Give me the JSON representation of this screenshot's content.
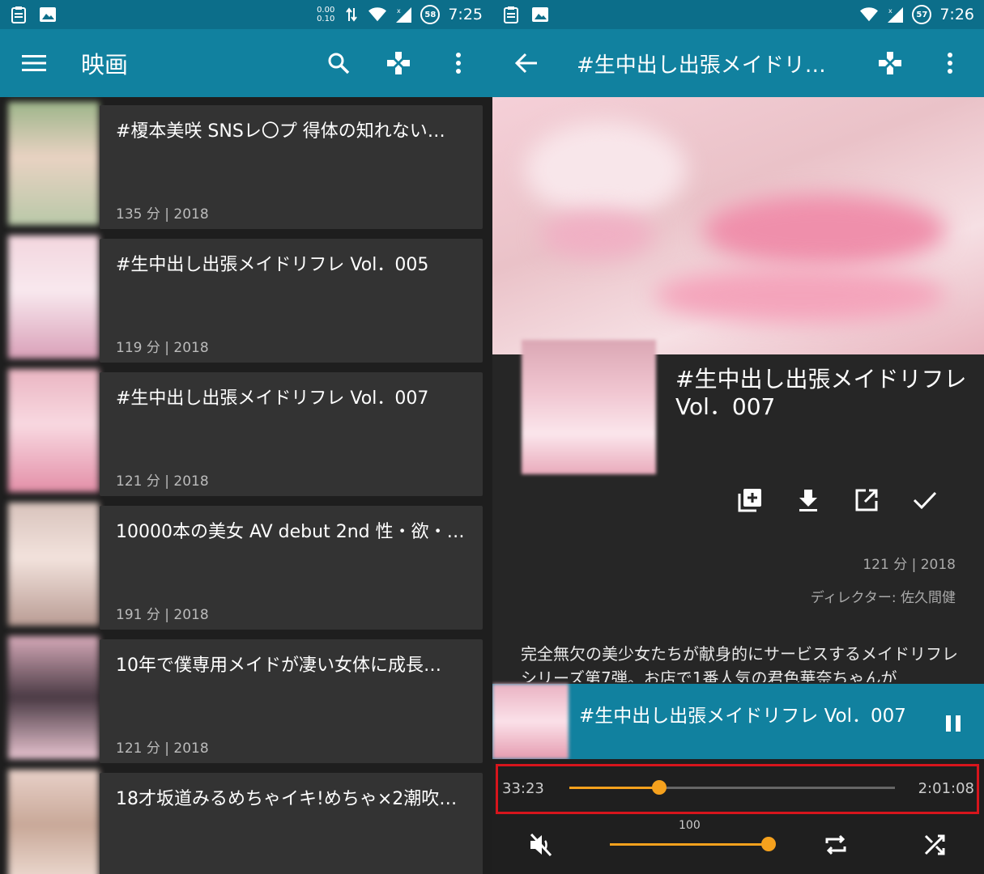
{
  "left": {
    "status": {
      "time": "7:25",
      "net_up": "0.00",
      "net_down": "0.10",
      "battery": "58"
    },
    "appbar": {
      "title": "映画"
    },
    "items": [
      {
        "title": "#榎本美咲 SNSレ〇プ 得体の知れない…",
        "meta": "135 分 | 2018",
        "colors": [
          "#b9c8a8",
          "#e8d2c2",
          "#9db58a"
        ]
      },
      {
        "title": "#生中出し出張メイドリフレ Vol．005",
        "meta": "119 分 | 2018",
        "colors": [
          "#f3d6de",
          "#f8e8ee",
          "#d9a0b8"
        ]
      },
      {
        "title": "#生中出し出張メイドリフレ Vol．007",
        "meta": "121 分 | 2018",
        "colors": [
          "#eab5c2",
          "#f8d8e0",
          "#e38fa8"
        ]
      },
      {
        "title": "10000本の美女 AV debut 2nd 性・欲・…",
        "meta": "191 分 | 2018",
        "colors": [
          "#d8c3bc",
          "#f2e2dc",
          "#b99c94"
        ]
      },
      {
        "title": "10年で僕専用メイドが凄い女体に成長…",
        "meta": "121 分 | 2018",
        "colors": [
          "#d5a9b8",
          "#4a3a44",
          "#e8c4d0"
        ]
      },
      {
        "title": "18才坂道みるめちゃイキ!めちゃ×2潮吹…",
        "meta": "",
        "colors": [
          "#e8d0c8",
          "#c8a898",
          "#f4e4dc"
        ]
      }
    ]
  },
  "right": {
    "status": {
      "time": "7:26",
      "battery": "57"
    },
    "appbar": {
      "title": "#生中出し出張メイドリ…"
    },
    "detail": {
      "title": "#生中出し出張メイドリフレ Vol．007",
      "duration_year": "121 分 | 2018",
      "director": "ディレクター: 佐久間健",
      "description": "完全無欠の美少女たちが献身的にサービスするメイドリフレシリーズ第7弾。お店で1番人気の君色華奈ちゃんが"
    },
    "now_playing": {
      "title": "#生中出し出張メイドリフレ Vol．007"
    },
    "player": {
      "elapsed": "33:23",
      "total": "2:01:08",
      "progress": 0.2757,
      "volume_label": "100",
      "volume": 1.0
    }
  },
  "colors": {
    "appbar": "#11819f",
    "statusbar": "#0c6e8a",
    "accent": "#f5a11d",
    "card": "#333333",
    "highlight": "#d7151c"
  }
}
